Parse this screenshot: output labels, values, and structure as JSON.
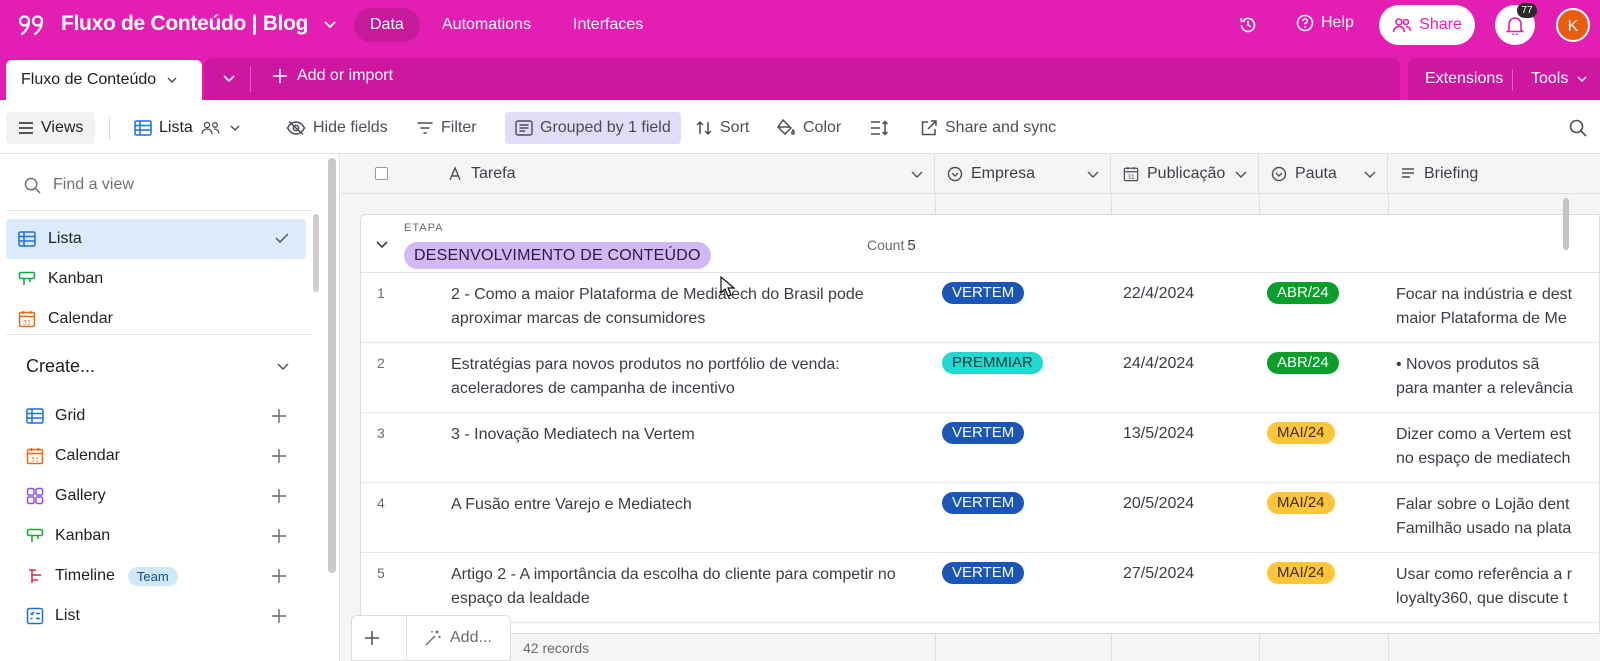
{
  "topbar": {
    "base_title": "Fluxo de Conteúdo | Blog",
    "nav": [
      "Data",
      "Automations",
      "Interfaces"
    ],
    "help": "Help",
    "share": "Share",
    "notifications": "77",
    "avatar_letter": "K",
    "color": "#e31fb3"
  },
  "tabs": {
    "table_name": "Fluxo de Conteúdo",
    "add_import": "Add or import",
    "extensions": "Extensions",
    "tools": "Tools"
  },
  "toolbar": {
    "views": "Views",
    "view_name": "Lista",
    "hide_fields": "Hide fields",
    "filter": "Filter",
    "grouped": "Grouped by 1 field",
    "sort": "Sort",
    "color": "Color",
    "share_sync": "Share and sync"
  },
  "sidebar": {
    "find_placeholder": "Find a view",
    "views": [
      {
        "label": "Lista",
        "icon": "grid-icon"
      },
      {
        "label": "Kanban",
        "icon": "kanban-icon"
      },
      {
        "label": "Calendar",
        "icon": "calendar-icon"
      }
    ],
    "create_label": "Create...",
    "create_items": [
      {
        "label": "Grid",
        "icon": "grid-icon"
      },
      {
        "label": "Calendar",
        "icon": "calendar-icon"
      },
      {
        "label": "Gallery",
        "icon": "gallery-icon"
      },
      {
        "label": "Kanban",
        "icon": "kanban-icon"
      },
      {
        "label": "Timeline",
        "icon": "timeline-icon",
        "badge": "Team"
      },
      {
        "label": "List",
        "icon": "list-icon"
      }
    ]
  },
  "grid": {
    "columns": [
      "Tarefa",
      "Empresa",
      "Publicação",
      "Pauta",
      "Briefing"
    ],
    "group": {
      "field": "ETAPA",
      "value": "DESENVOLVIMENTO DE CONTEÚDO",
      "count_label": "Count",
      "count": "5"
    },
    "rows": [
      {
        "num": "1",
        "task": "2 - Como a maior Plataforma de Mediatech do Brasil pode aproximar marcas de consumidores",
        "empresa": "VERTEM",
        "date": "22/4/2024",
        "pauta": "ABR/24",
        "briefing": [
          "Focar na indústria e dest",
          "maior Plataforma de Me"
        ]
      },
      {
        "num": "2",
        "task": "Estratégias para novos produtos no portfólio de venda: aceleradores de campanha de incentivo",
        "empresa": "PREMMIAR",
        "date": "24/4/2024",
        "pauta": "ABR/24",
        "briefing": [
          "•      Novos produtos sã",
          "para manter a relevância"
        ]
      },
      {
        "num": "3",
        "task": "3 - Inovação Mediatech na Vertem",
        "empresa": "VERTEM",
        "date": "13/5/2024",
        "pauta": "MAI/24",
        "briefing": [
          "Dizer como a Vertem est",
          "no espaço de mediatech"
        ]
      },
      {
        "num": "4",
        "task": "A Fusão entre Varejo e Mediatech",
        "empresa": "VERTEM",
        "date": "20/5/2024",
        "pauta": "MAI/24",
        "briefing": [
          "Falar sobre o Lojão dent",
          "Familhão usado na plata"
        ]
      },
      {
        "num": "5",
        "task": "Artigo 2 - A importância da escolha do cliente para competir no espaço da lealdade",
        "empresa": "VERTEM",
        "date": "27/5/2024",
        "pauta": "MAI/24",
        "briefing": [
          "Usar como referência a r",
          "loyalty360, que discute t"
        ]
      }
    ],
    "pill_colors": {
      "VERTEM": {
        "bg": "#1a56b8",
        "fg": "#ffffff"
      },
      "PREMMIAR": {
        "bg": "#20d9d2",
        "fg": "#0b3b3a"
      },
      "ABR/24": {
        "bg": "#0a9e2b",
        "fg": "#ffffff"
      },
      "MAI/24": {
        "bg": "#fcc53a",
        "fg": "#3f2a00"
      }
    },
    "footer_add": "Add...",
    "records": "42 records"
  }
}
